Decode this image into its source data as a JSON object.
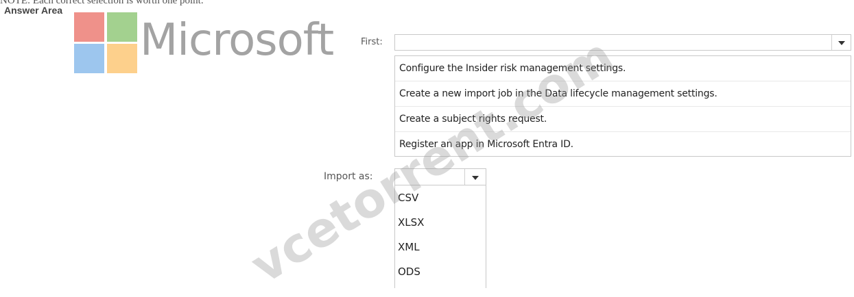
{
  "header": {
    "cut_text": "NOTE: Each correct selection is worth one point.",
    "answer_area": "Answer Area"
  },
  "logo": {
    "word": "Microsoft",
    "colors": {
      "red": "#ef918a",
      "green": "#a3d18f",
      "blue": "#9dc6ee",
      "yellow": "#fdd08c"
    }
  },
  "first": {
    "label": "First:",
    "selected_value": "",
    "options": [
      "Configure the Insider risk management settings.",
      "Create a new import job in the Data lifecycle management settings.",
      "Create a subject rights request.",
      "Register an app in Microsoft Entra ID."
    ]
  },
  "import_as": {
    "label": "Import as:",
    "selected_value": "",
    "options": [
      "CSV",
      "XLSX",
      "XML",
      "ODS"
    ]
  },
  "watermark": "vcetorrent.com",
  "icons": {
    "dropdown": "caret-down-icon"
  }
}
